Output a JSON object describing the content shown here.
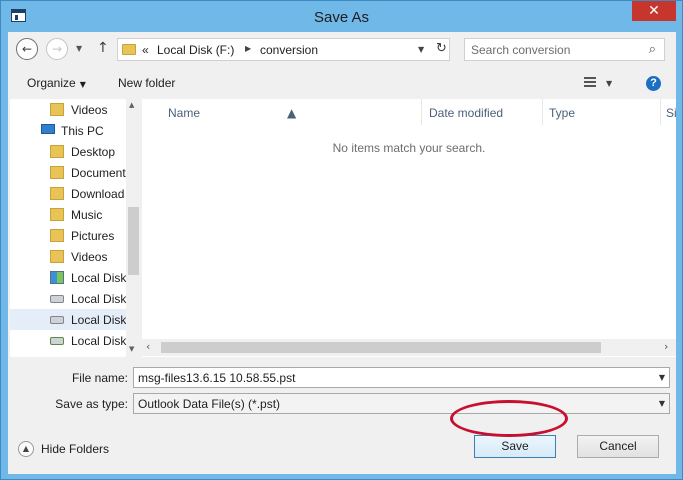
{
  "window": {
    "title": "Save As",
    "close_glyph": "✕"
  },
  "address_bar": {
    "back_glyph": "←",
    "forward_glyph": "→",
    "up_glyph": "↑",
    "overflow": "«",
    "crumbs": [
      "Local Disk (F:)",
      "conversion"
    ],
    "refresh_glyph": "↻"
  },
  "search": {
    "placeholder": "Search conversion",
    "icon_glyph": "⌕"
  },
  "toolbar": {
    "organize": "Organize",
    "new_folder": "New folder",
    "help": "?"
  },
  "nav_pane": {
    "items": [
      {
        "label": "Videos",
        "icon": "folder-icon"
      },
      {
        "label": "This PC",
        "icon": "computer-icon"
      },
      {
        "label": "Desktop",
        "icon": "folder-icon"
      },
      {
        "label": "Document",
        "icon": "folder-icon"
      },
      {
        "label": "Download",
        "icon": "folder-icon"
      },
      {
        "label": "Music",
        "icon": "folder-icon"
      },
      {
        "label": "Pictures",
        "icon": "folder-icon"
      },
      {
        "label": "Videos",
        "icon": "folder-icon"
      },
      {
        "label": "Local Disk",
        "icon": "windows-drive-icon"
      },
      {
        "label": "Local Disk",
        "icon": "drive-icon"
      },
      {
        "label": "Local Disk",
        "icon": "drive-icon",
        "selected": true
      },
      {
        "label": "Local Disk",
        "icon": "network-drive-icon"
      }
    ]
  },
  "file_list": {
    "columns": [
      "Name",
      "Date modified",
      "Type",
      "Size"
    ],
    "empty_message": "No items match your search."
  },
  "form": {
    "file_name_label": "File name:",
    "file_name_value": "msg-files13.6.15 10.58.55.pst",
    "save_as_type_label": "Save as type:",
    "save_as_type_value": "Outlook Data File(s) (*.pst)"
  },
  "footer": {
    "hide_folders": "Hide Folders",
    "save": "Save",
    "cancel": "Cancel"
  },
  "colors": {
    "window_frame": "#6fb8e8",
    "close_button": "#c7362c",
    "highlight_ring": "#c8102e"
  }
}
